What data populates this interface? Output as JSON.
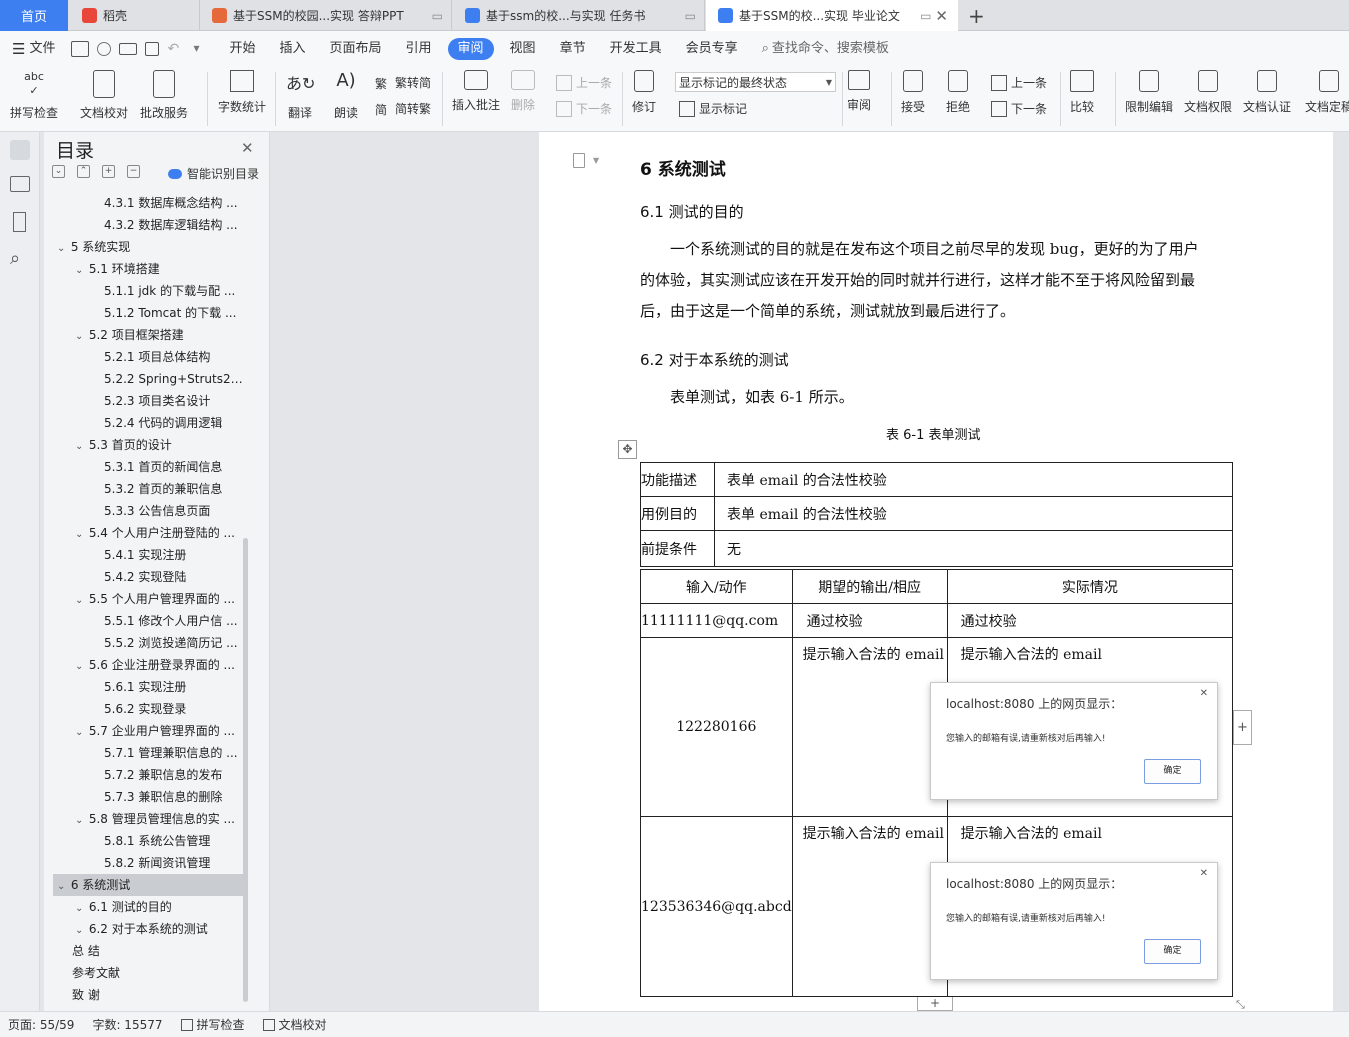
{
  "tabs": [
    {
      "label": "首页"
    },
    {
      "label": "稻壳"
    },
    {
      "label": "基于SSM的校园...实现 答辩PPT"
    },
    {
      "label": "基于ssm的校...与实现 任务书"
    },
    {
      "label": "基于SSM的校...实现 毕业论文"
    }
  ],
  "menu": {
    "file": "文件",
    "items": [
      "开始",
      "插入",
      "页面布局",
      "引用",
      "审阅",
      "视图",
      "章节",
      "开发工具",
      "会员专享"
    ],
    "search": "查找命令、搜索模板"
  },
  "ribbon": {
    "spell": "拼写检查",
    "doc_check": "文档校对",
    "batch": "批改服务",
    "word_count": "字数统计",
    "translate": "翻译",
    "read": "朗读",
    "to_trad": "繁转简",
    "to_simp": "简转繁",
    "insert_comment": "插入批注",
    "delete": "删除",
    "prev_comment": "上一条",
    "next_comment": "下一条",
    "revise": "修订",
    "markup_state": "显示标记的最终状态",
    "show_markup": "显示标记",
    "review": "审阅",
    "accept": "接受",
    "reject": "拒绝",
    "prev": "上一条",
    "next": "下一条",
    "compare": "比较",
    "restrict": "限制编辑",
    "permission": "文档权限",
    "certify": "文档认证",
    "finalize": "文档定稿"
  },
  "toc": {
    "title": "目录",
    "smart": "智能识别目录",
    "items": [
      {
        "text": "4.3.1  数据库概念结构 ...",
        "level": 3
      },
      {
        "text": "4.3.2  数据库逻辑结构 ...",
        "level": 3
      },
      {
        "text": "5  系统实现",
        "level": 1
      },
      {
        "text": "5.1  环境搭建",
        "level": 2
      },
      {
        "text": "5.1.1 jdk 的下载与配 ...",
        "level": 3
      },
      {
        "text": "5.1.2 Tomcat 的下载 ...",
        "level": 3
      },
      {
        "text": "5.2  项目框架搭建",
        "level": 2
      },
      {
        "text": "5.2.1  项目总体结构",
        "level": 3
      },
      {
        "text": "5.2.2 Spring+Struts2 ...",
        "level": 3
      },
      {
        "text": "5.2.3  项目类名设计",
        "level": 3
      },
      {
        "text": "5.2.4  代码的调用逻辑",
        "level": 3
      },
      {
        "text": "5.3  首页的设计",
        "level": 2
      },
      {
        "text": "5.3.1  首页的新闻信息",
        "level": 3
      },
      {
        "text": "5.3.2  首页的兼职信息",
        "level": 3
      },
      {
        "text": "5.3.3  公告信息页面",
        "level": 3
      },
      {
        "text": "5.4  个人用户注册登陆的 ...",
        "level": 2
      },
      {
        "text": "5.4.1  实现注册",
        "level": 3
      },
      {
        "text": "5.4.2  实现登陆",
        "level": 3
      },
      {
        "text": "5.5  个人用户管理界面的 ...",
        "level": 2
      },
      {
        "text": "5.5.1  修改个人用户信 ...",
        "level": 3
      },
      {
        "text": "5.5.2  浏览投递简历记 ...",
        "level": 3
      },
      {
        "text": "5.6  企业注册登录界面的 ...",
        "level": 2
      },
      {
        "text": "5.6.1  实现注册",
        "level": 3
      },
      {
        "text": "5.6.2  实现登录",
        "level": 3
      },
      {
        "text": "5.7  企业用户管理界面的 ...",
        "level": 2
      },
      {
        "text": "5.7.1  管理兼职信息的 ...",
        "level": 3
      },
      {
        "text": "5.7.2  兼职信息的发布",
        "level": 3
      },
      {
        "text": "5.7.3  兼职信息的删除",
        "level": 3
      },
      {
        "text": "5.8  管理员管理信息的实 ...",
        "level": 2
      },
      {
        "text": "5.8.1  系统公告管理",
        "level": 3
      },
      {
        "text": "5.8.2  新闻资讯管理",
        "level": 3
      },
      {
        "text": "6  系统测试",
        "level": 1,
        "selected": true
      },
      {
        "text": "6.1  测试的目的",
        "level": 2
      },
      {
        "text": "6.2  对于本系统的测试",
        "level": 2
      },
      {
        "text": "总    结",
        "level": 0
      },
      {
        "text": "参考文献",
        "level": 0
      },
      {
        "text": "致      谢",
        "level": 0
      }
    ]
  },
  "doc": {
    "h1": "6  系统测试",
    "h2a": "6.1  测试的目的",
    "p1_l1": "一个系统测试的目的就是在发布这个项目之前尽早的发现 bug，更好的为了用户",
    "p1_l2": "的体验，其实测试应该在开发开始的同时就并行进行，这样才能不至于将风险留到最",
    "p1_l3": "后，由于这是一个简单的系统，测试就放到最后进行了。",
    "h2b": "6.2  对于本系统的测试",
    "p2": "表单测试，如表 6-1 所示。",
    "caption": "表 6-1  表单测试"
  },
  "table": {
    "func_label": "功能描述",
    "func_value": "表单 email 的合法性校验",
    "purpose_label": "用例目的",
    "purpose_value": "表单 email 的合法性校验",
    "pre_label": "前提条件",
    "pre_value": "无",
    "col1": "输入/动作",
    "col2": "期望的输出/相应",
    "col3": "实际情况",
    "r1": [
      "11111111@qq.com",
      "通过校验",
      "通过校验"
    ],
    "r2": [
      "122280166",
      "提示输入合法的 email",
      "提示输入合法的 email"
    ],
    "r3": [
      "123536346@qq.abcd",
      "提示输入合法的 email",
      "提示输入合法的 email"
    ]
  },
  "dialog": {
    "title": "localhost:8080 上的网页显示：",
    "message": "您输入的邮箱有误,请重新核对后再输入!",
    "ok": "确定"
  },
  "status": {
    "page": "页面: 55/59",
    "words": "字数: 15577",
    "spell": "拼写检查",
    "check": "文档校对"
  },
  "colors": {
    "accent": "#3d7ef1",
    "toc_selected": "#c9ccd1"
  }
}
